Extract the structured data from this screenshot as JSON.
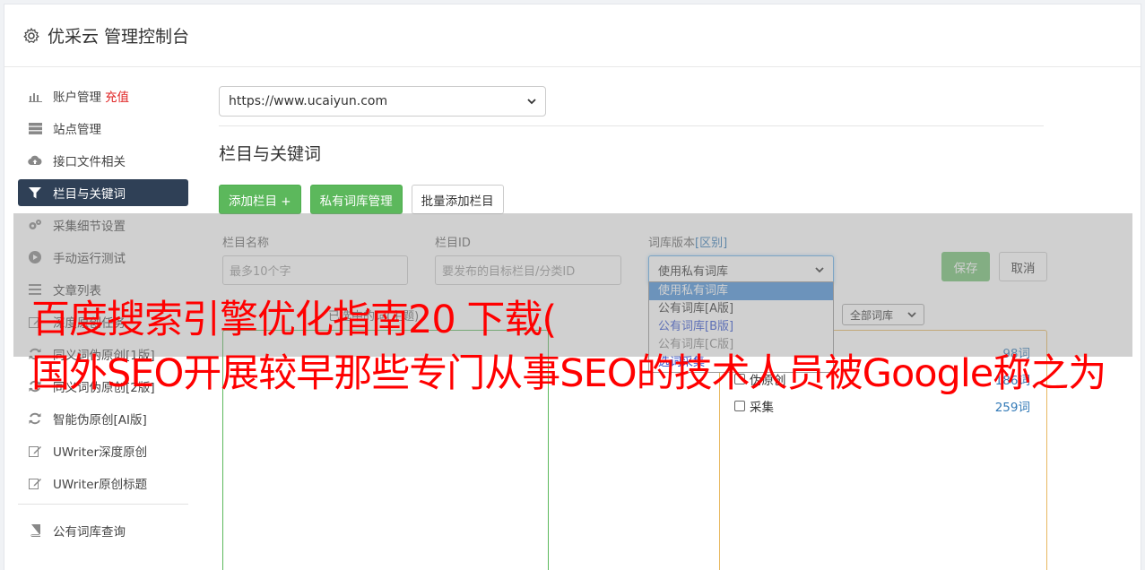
{
  "header": {
    "title": "优采云 管理控制台",
    "icon": "gear-icon"
  },
  "sidebar": {
    "items": [
      {
        "label": "账户管理",
        "extra": "充值",
        "icon": "bar-chart-icon"
      },
      {
        "label": "站点管理",
        "icon": "server-icon"
      },
      {
        "label": "接口文件相关",
        "icon": "cloud-upload-icon"
      },
      {
        "label": "栏目与关键词",
        "icon": "filter-icon",
        "active": true
      },
      {
        "label": "采集细节设置",
        "icon": "cogs-icon"
      },
      {
        "label": "手动运行测试",
        "icon": "play-icon"
      },
      {
        "label": "文章列表",
        "icon": "list-icon"
      },
      {
        "label": "深度原创任务",
        "icon": "edit-icon"
      },
      {
        "label": "同义词伪原创[1版]",
        "icon": "refresh-icon"
      },
      {
        "label": "同义词伪原创[2版]",
        "icon": "refresh-icon"
      },
      {
        "label": "智能伪原创[AI版]",
        "icon": "refresh-icon"
      },
      {
        "label": "UWriter深度原创",
        "icon": "edit-icon"
      },
      {
        "label": "UWriter原创标题",
        "icon": "edit-icon"
      }
    ],
    "bottom_items": [
      {
        "label": "公有词库查询",
        "icon": "book-icon"
      }
    ]
  },
  "main": {
    "site_select": "https://www.ucaiyun.com",
    "section_title": "栏目与关键词",
    "buttons": {
      "add_column": "添加栏目 +",
      "private_lib": "私有词库管理",
      "batch_add": "批量添加栏目"
    },
    "form": {
      "name_label": "栏目名称",
      "name_placeholder": "最多10个字",
      "id_label": "栏目ID",
      "id_placeholder": "要发布的目标栏目/分类ID",
      "lib_label": "词库版本",
      "lib_label_link": "[区别]",
      "lib_selected": "使用私有词库",
      "save": "保存",
      "cancel": "取消"
    },
    "dropdown_options": [
      "使用私有词库",
      "公有词库[A版]",
      "公有词库[B版]",
      "公有词库[C版]",
      "选词采集"
    ],
    "hint": "已选中的词(主题)",
    "lib_filter": "全部词库",
    "right_box": [
      {
        "label": "",
        "count": "98词"
      },
      {
        "label": "伪原创",
        "count": "186词"
      },
      {
        "label": "采集",
        "count": "259词"
      }
    ]
  },
  "overlay_text": {
    "line1": "百度搜索引擎优化指南20 下载(",
    "line2": "国外SEO开展较早那些专门从事SEO的技术人员被Google称之为"
  },
  "colors": {
    "active_bg": "#2f4056",
    "green": "#5cb85c",
    "red": "#ff0000",
    "link": "#337ab7"
  }
}
